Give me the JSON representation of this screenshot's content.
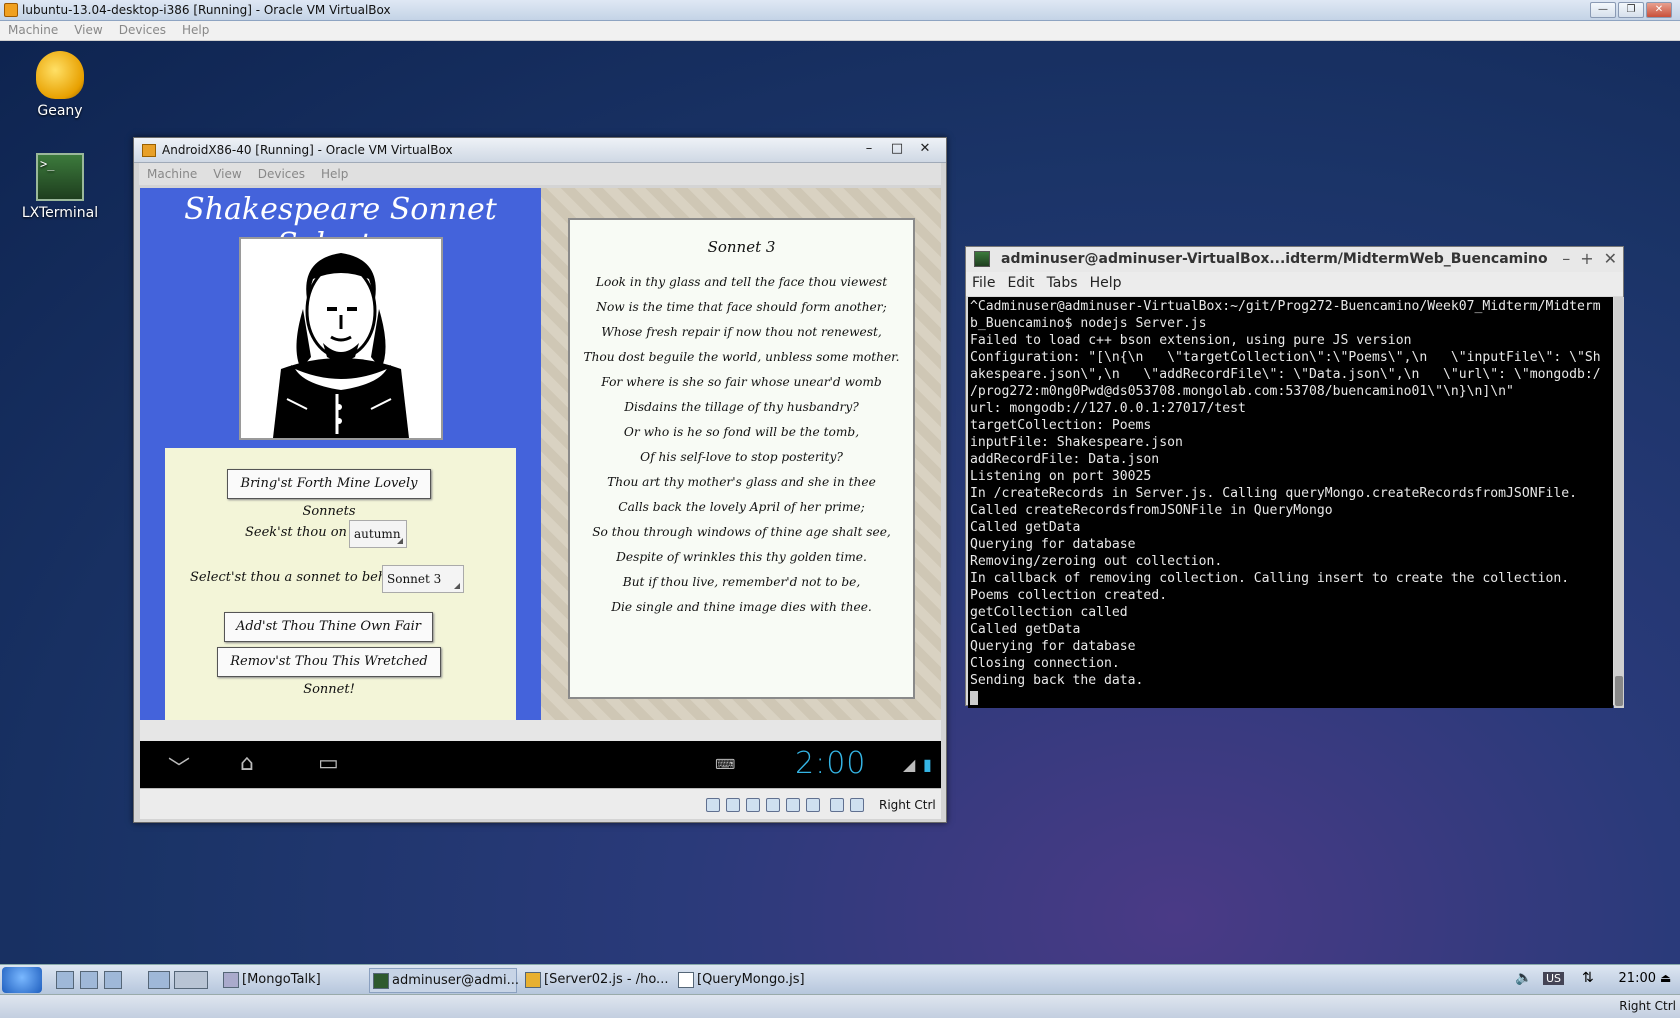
{
  "host_window": {
    "title": "lubuntu-13.04-desktop-i386 [Running] - Oracle VM VirtualBox",
    "menu": [
      "Machine",
      "View",
      "Devices",
      "Help"
    ],
    "controls": [
      "minimize",
      "restore",
      "close"
    ]
  },
  "desktop_icons": [
    {
      "label": "Geany",
      "icon": "teapot-icon"
    },
    {
      "label": "LXTerminal",
      "icon": "terminal-icon"
    }
  ],
  "android_window": {
    "title": "AndroidX86-40 [Running] - Oracle VM VirtualBox",
    "menu": [
      "Machine",
      "View",
      "Devices",
      "Help"
    ],
    "app": {
      "title": "Shakespeare Sonnet Selector",
      "bring_button": "Bring'st Forth Mine Lovely Sonnets",
      "seek_label": "Seek'st thou on ...",
      "seek_value": "autumn",
      "select_label": "Select'st thou a sonnet to behold ...",
      "select_value": "Sonnet 3",
      "add_button": "Add'st Thou Thine Own Fair Sonnet",
      "remove_button": "Remov'st Thou This Wretched Sonnet!",
      "poem_title": "Sonnet 3",
      "poem_lines": [
        "Look in thy glass and tell the face thou viewest",
        "Now is the time that face should form another;",
        "Whose fresh repair if now thou not renewest,",
        "Thou dost beguile the world, unbless some mother.",
        "For where is she so fair whose unear'd womb",
        "Disdains the tillage of thy husbandry?",
        "Or who is he so fond will be the tomb,",
        "Of his self-love to stop posterity?",
        "Thou art thy mother's glass and she in thee",
        "Calls back the lovely April of her prime;",
        "So thou through windows of thine age shalt see,",
        "Despite of wrinkles this thy golden time.",
        "But if thou live, remember'd not to be,",
        "Die single and thine image dies with thee."
      ]
    },
    "clock": "2:00",
    "host_key": "Right Ctrl"
  },
  "terminal": {
    "title": "adminuser@adminuser-VirtualBox...idterm/MidtermWeb_Buencamino",
    "menu": [
      "File",
      "Edit",
      "Tabs",
      "Help"
    ],
    "lines": [
      "^Cadminuser@adminuser-VirtualBox:~/git/Prog272-Buencamino/Week07_Midterm/Midterm",
      "b_Buencamino$ nodejs Server.js",
      "Failed to load c++ bson extension, using pure JS version",
      "Configuration: \"[\\n{\\n   \\\"targetCollection\\\":\\\"Poems\\\",\\n   \\\"inputFile\\\": \\\"Sh",
      "akespeare.json\\\",\\n   \\\"addRecordFile\\\": \\\"Data.json\\\",\\n   \\\"url\\\": \\\"mongodb:/",
      "/prog272:m0ng0Pwd@ds053708.mongolab.com:53708/buencamino01\\\"\\n}\\n]\\n\"",
      "url: mongodb://127.0.0.1:27017/test",
      "targetCollection: Poems",
      "inputFile: Shakespeare.json",
      "addRecordFile: Data.json",
      "Listening on port 30025",
      "In /createRecords in Server.js. Calling queryMongo.createRecordsfromJSONFile.",
      "Called createRecordsfromJSONFile in QueryMongo",
      "Called getData",
      "Querying for database",
      "Removing/zeroing out collection.",
      "In callback of removing collection. Calling insert to create the collection.",
      "Poems collection created.",
      "getCollection called",
      "Called getData",
      "Querying for database",
      "Closing connection.",
      "Sending back the data."
    ]
  },
  "taskbar": {
    "tasks": [
      "[MongoTalk]",
      "adminuser@admi...",
      "[Server02.js - /ho...",
      "[QueryMongo.js]"
    ],
    "keyboard": "US",
    "clock": "21:00"
  },
  "bottom_strip": {
    "host_key": "Right Ctrl"
  }
}
